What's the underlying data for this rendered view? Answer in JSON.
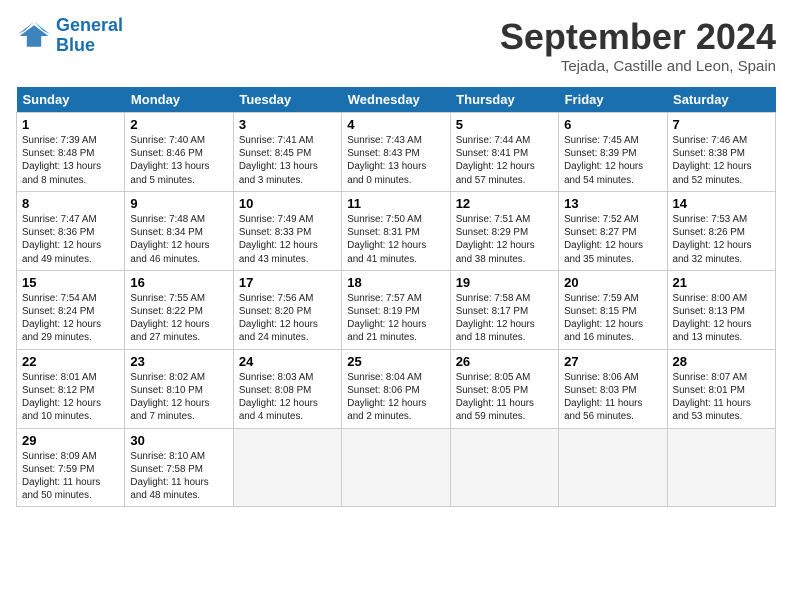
{
  "header": {
    "logo_line1": "General",
    "logo_line2": "Blue",
    "month": "September 2024",
    "location": "Tejada, Castille and Leon, Spain"
  },
  "weekdays": [
    "Sunday",
    "Monday",
    "Tuesday",
    "Wednesday",
    "Thursday",
    "Friday",
    "Saturday"
  ],
  "weeks": [
    [
      {
        "day": "1",
        "text": "Sunrise: 7:39 AM\nSunset: 8:48 PM\nDaylight: 13 hours\nand 8 minutes."
      },
      {
        "day": "2",
        "text": "Sunrise: 7:40 AM\nSunset: 8:46 PM\nDaylight: 13 hours\nand 5 minutes."
      },
      {
        "day": "3",
        "text": "Sunrise: 7:41 AM\nSunset: 8:45 PM\nDaylight: 13 hours\nand 3 minutes."
      },
      {
        "day": "4",
        "text": "Sunrise: 7:43 AM\nSunset: 8:43 PM\nDaylight: 13 hours\nand 0 minutes."
      },
      {
        "day": "5",
        "text": "Sunrise: 7:44 AM\nSunset: 8:41 PM\nDaylight: 12 hours\nand 57 minutes."
      },
      {
        "day": "6",
        "text": "Sunrise: 7:45 AM\nSunset: 8:39 PM\nDaylight: 12 hours\nand 54 minutes."
      },
      {
        "day": "7",
        "text": "Sunrise: 7:46 AM\nSunset: 8:38 PM\nDaylight: 12 hours\nand 52 minutes."
      }
    ],
    [
      {
        "day": "8",
        "text": "Sunrise: 7:47 AM\nSunset: 8:36 PM\nDaylight: 12 hours\nand 49 minutes."
      },
      {
        "day": "9",
        "text": "Sunrise: 7:48 AM\nSunset: 8:34 PM\nDaylight: 12 hours\nand 46 minutes."
      },
      {
        "day": "10",
        "text": "Sunrise: 7:49 AM\nSunset: 8:33 PM\nDaylight: 12 hours\nand 43 minutes."
      },
      {
        "day": "11",
        "text": "Sunrise: 7:50 AM\nSunset: 8:31 PM\nDaylight: 12 hours\nand 41 minutes."
      },
      {
        "day": "12",
        "text": "Sunrise: 7:51 AM\nSunset: 8:29 PM\nDaylight: 12 hours\nand 38 minutes."
      },
      {
        "day": "13",
        "text": "Sunrise: 7:52 AM\nSunset: 8:27 PM\nDaylight: 12 hours\nand 35 minutes."
      },
      {
        "day": "14",
        "text": "Sunrise: 7:53 AM\nSunset: 8:26 PM\nDaylight: 12 hours\nand 32 minutes."
      }
    ],
    [
      {
        "day": "15",
        "text": "Sunrise: 7:54 AM\nSunset: 8:24 PM\nDaylight: 12 hours\nand 29 minutes."
      },
      {
        "day": "16",
        "text": "Sunrise: 7:55 AM\nSunset: 8:22 PM\nDaylight: 12 hours\nand 27 minutes."
      },
      {
        "day": "17",
        "text": "Sunrise: 7:56 AM\nSunset: 8:20 PM\nDaylight: 12 hours\nand 24 minutes."
      },
      {
        "day": "18",
        "text": "Sunrise: 7:57 AM\nSunset: 8:19 PM\nDaylight: 12 hours\nand 21 minutes."
      },
      {
        "day": "19",
        "text": "Sunrise: 7:58 AM\nSunset: 8:17 PM\nDaylight: 12 hours\nand 18 minutes."
      },
      {
        "day": "20",
        "text": "Sunrise: 7:59 AM\nSunset: 8:15 PM\nDaylight: 12 hours\nand 16 minutes."
      },
      {
        "day": "21",
        "text": "Sunrise: 8:00 AM\nSunset: 8:13 PM\nDaylight: 12 hours\nand 13 minutes."
      }
    ],
    [
      {
        "day": "22",
        "text": "Sunrise: 8:01 AM\nSunset: 8:12 PM\nDaylight: 12 hours\nand 10 minutes."
      },
      {
        "day": "23",
        "text": "Sunrise: 8:02 AM\nSunset: 8:10 PM\nDaylight: 12 hours\nand 7 minutes."
      },
      {
        "day": "24",
        "text": "Sunrise: 8:03 AM\nSunset: 8:08 PM\nDaylight: 12 hours\nand 4 minutes."
      },
      {
        "day": "25",
        "text": "Sunrise: 8:04 AM\nSunset: 8:06 PM\nDaylight: 12 hours\nand 2 minutes."
      },
      {
        "day": "26",
        "text": "Sunrise: 8:05 AM\nSunset: 8:05 PM\nDaylight: 11 hours\nand 59 minutes."
      },
      {
        "day": "27",
        "text": "Sunrise: 8:06 AM\nSunset: 8:03 PM\nDaylight: 11 hours\nand 56 minutes."
      },
      {
        "day": "28",
        "text": "Sunrise: 8:07 AM\nSunset: 8:01 PM\nDaylight: 11 hours\nand 53 minutes."
      }
    ],
    [
      {
        "day": "29",
        "text": "Sunrise: 8:09 AM\nSunset: 7:59 PM\nDaylight: 11 hours\nand 50 minutes."
      },
      {
        "day": "30",
        "text": "Sunrise: 8:10 AM\nSunset: 7:58 PM\nDaylight: 11 hours\nand 48 minutes."
      },
      {
        "day": "",
        "text": ""
      },
      {
        "day": "",
        "text": ""
      },
      {
        "day": "",
        "text": ""
      },
      {
        "day": "",
        "text": ""
      },
      {
        "day": "",
        "text": ""
      }
    ]
  ]
}
